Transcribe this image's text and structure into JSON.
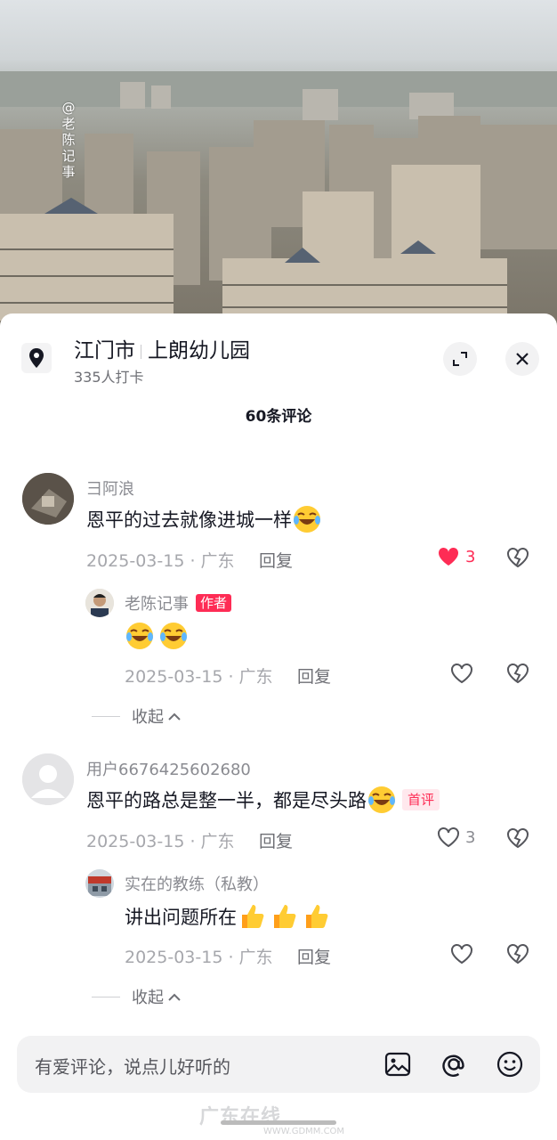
{
  "photo": {
    "watermark": "@老陈记事"
  },
  "location": {
    "city": "江门市",
    "place": "上朗幼儿园",
    "checkins": "335人打卡"
  },
  "comments_count": "60条评论",
  "comments": [
    {
      "user": "彐阿浪",
      "text": "恩平的过去就像进城一样",
      "date": "2025-03-15 · 广东",
      "reply": "回复",
      "likes": "3",
      "liked": true,
      "sub": {
        "user": "老陈记事",
        "badge": "作者",
        "date": "2025-03-15 · 广东",
        "reply": "回复"
      },
      "collapse": "收起"
    },
    {
      "user": "用户6676425602680",
      "text": "恩平的路总是整一半，都是尽头路",
      "badge": "首评",
      "date": "2025-03-15 · 广东",
      "reply": "回复",
      "likes": "3",
      "sub": {
        "user": "实在的教练（私教）",
        "text": "讲出问题所在",
        "date": "2025-03-15 · 广东",
        "reply": "回复"
      },
      "collapse": "收起"
    }
  ],
  "input": {
    "placeholder": "有爱评论，说点儿好听的"
  },
  "site_mark": {
    "name": "广东在线",
    "url": "WWW.GDMM.COM"
  },
  "colors": {
    "accent": "#fe2c55",
    "text": "#161823",
    "muted": "#a6a7ac"
  }
}
